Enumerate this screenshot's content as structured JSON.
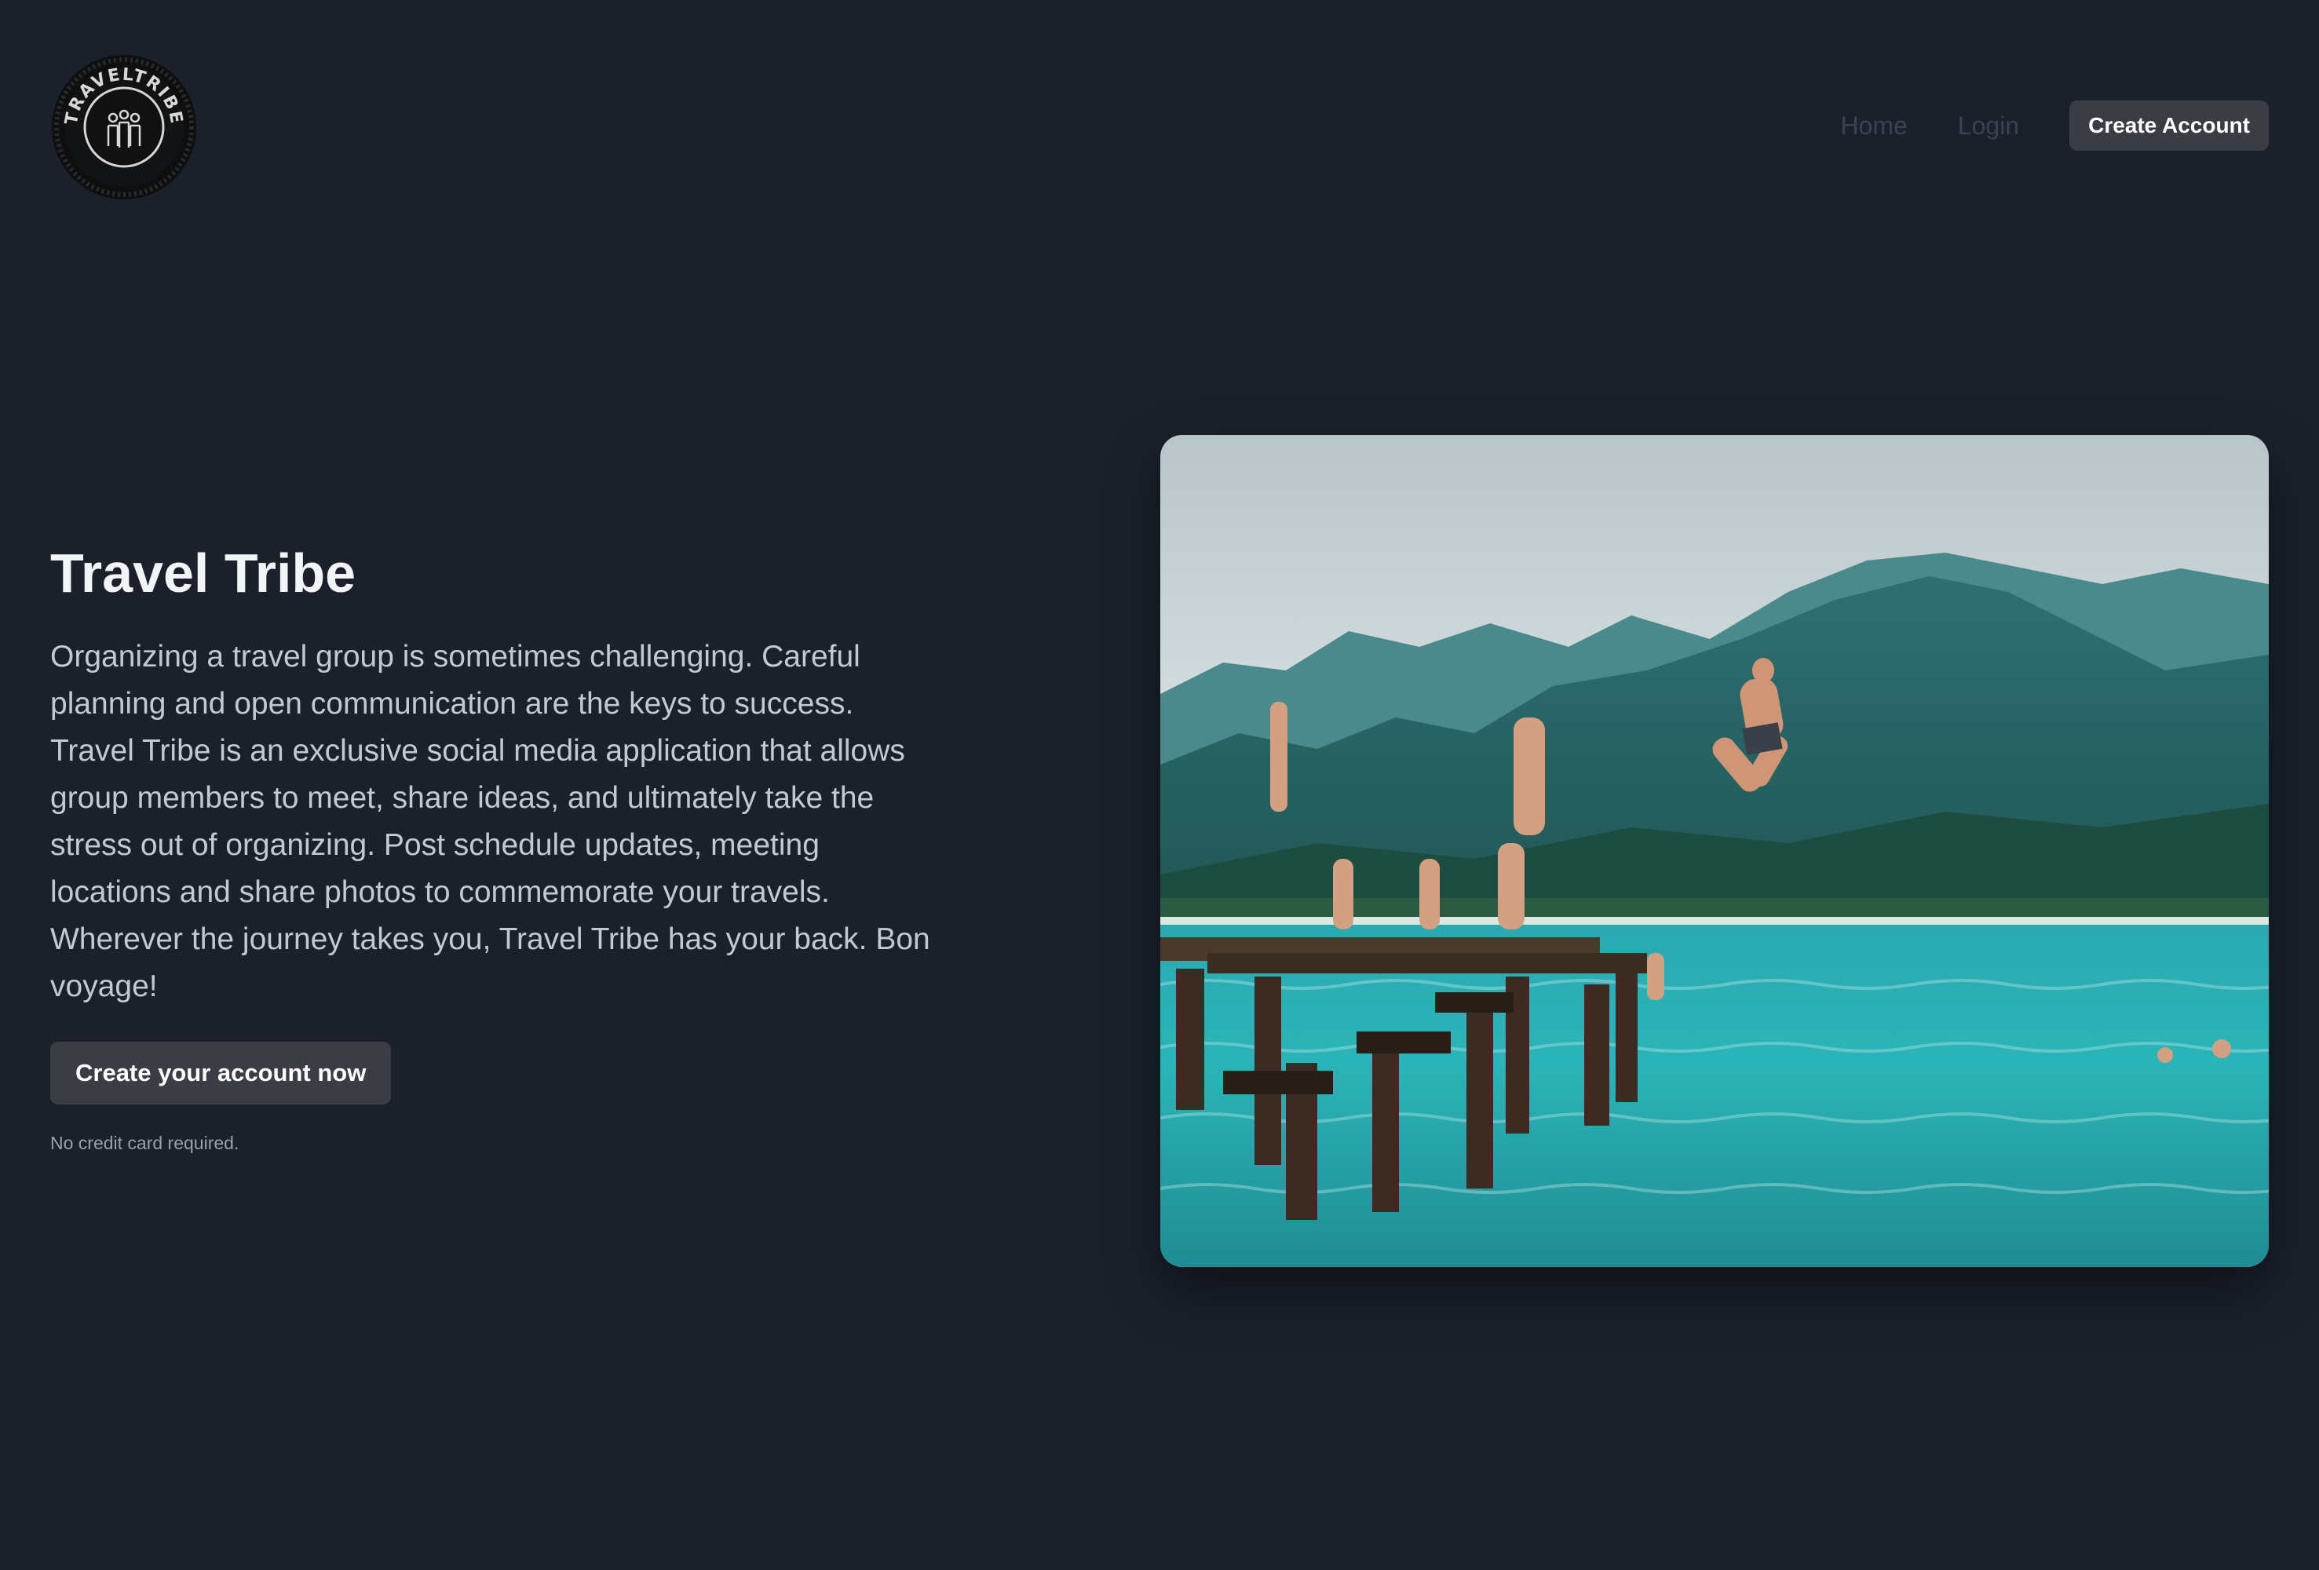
{
  "brand": {
    "name": "TRAVELTRIBE",
    "logo_icon": "traveltribe-badge-logo"
  },
  "nav": {
    "home": "Home",
    "login": "Login",
    "create_account": "Create Account"
  },
  "hero": {
    "title": "Travel Tribe",
    "description": "Organizing a travel group is sometimes challenging. Careful planning and open communication are the keys to success. Travel Tribe is an exclusive social media application that allows group members to meet, share ideas, and ultimately take the stress out of organizing. Post schedule updates, meeting locations and share photos to commemorate your travels. Wherever the journey takes you, Travel Tribe has your back. Bon voyage!",
    "cta_label": "Create your account now",
    "fine_print": "No credit card required.",
    "image_icon": "people-on-pier-photo"
  },
  "colors": {
    "background": "#1b202b",
    "button": "#3a3e44",
    "nav_link": "#3b4252"
  }
}
